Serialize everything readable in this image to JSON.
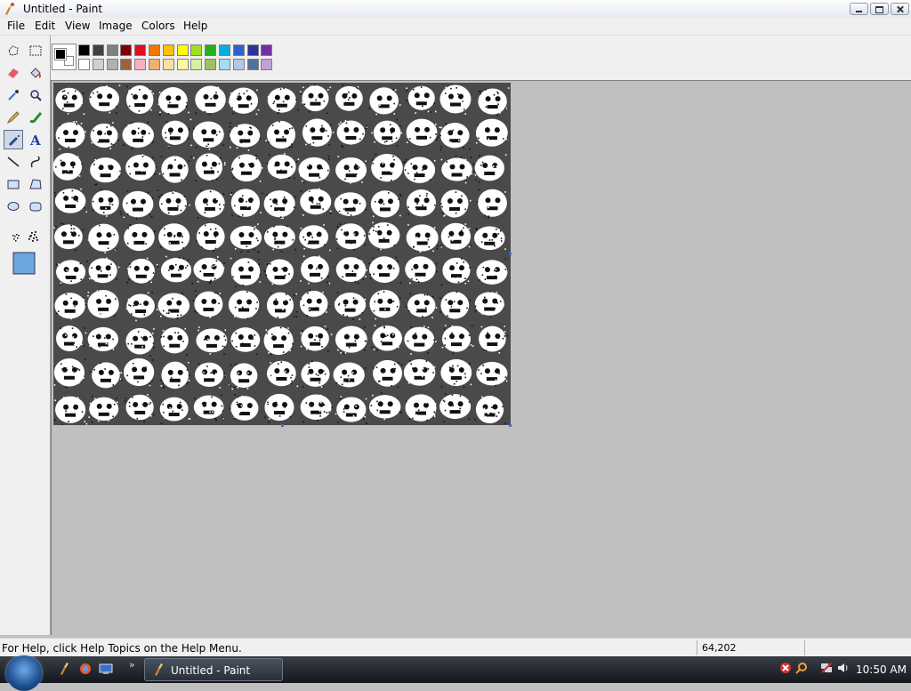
{
  "window": {
    "title": "Untitled - Paint"
  },
  "menu": [
    "File",
    "Edit",
    "View",
    "Image",
    "Colors",
    "Help"
  ],
  "palette": {
    "top": [
      "#000000",
      "#404040",
      "#808080",
      "#800000",
      "#e01020",
      "#f07800",
      "#ffc000",
      "#ffff00",
      "#a0e020",
      "#20b020",
      "#00b0e0",
      "#3060d0",
      "#3030a0",
      "#7030a0"
    ],
    "bottom": [
      "#ffffff",
      "#d0d0d0",
      "#b0b0b0",
      "#a06040",
      "#f8b0c0",
      "#f0b070",
      "#f8e0a0",
      "#fff8a0",
      "#d8f0a0",
      "#a0c060",
      "#a0e0f0",
      "#b0c8e8",
      "#5070a0",
      "#c0a0d8"
    ],
    "foreground": "#000000",
    "background": "#ffffff"
  },
  "tools": [
    {
      "name": "free-form-select-icon"
    },
    {
      "name": "select-icon"
    },
    {
      "name": "eraser-icon"
    },
    {
      "name": "fill-bucket-icon"
    },
    {
      "name": "color-picker-icon"
    },
    {
      "name": "magnifier-icon"
    },
    {
      "name": "pencil-icon"
    },
    {
      "name": "brush-icon"
    },
    {
      "name": "airbrush-icon",
      "active": true
    },
    {
      "name": "text-icon"
    },
    {
      "name": "line-icon"
    },
    {
      "name": "curve-icon"
    },
    {
      "name": "rectangle-icon"
    },
    {
      "name": "polygon-icon"
    },
    {
      "name": "ellipse-icon"
    },
    {
      "name": "rounded-rectangle-icon"
    }
  ],
  "status": {
    "help": "For Help, click Help Topics on the Help Menu.",
    "coords": "64,202"
  },
  "taskbar": {
    "task_label": "Untitled - Paint",
    "clock": "10:50 AM"
  },
  "canvas": {
    "background": "#4a4a4a",
    "face_color": "#ffffff",
    "rows": 10,
    "cols": 13
  }
}
